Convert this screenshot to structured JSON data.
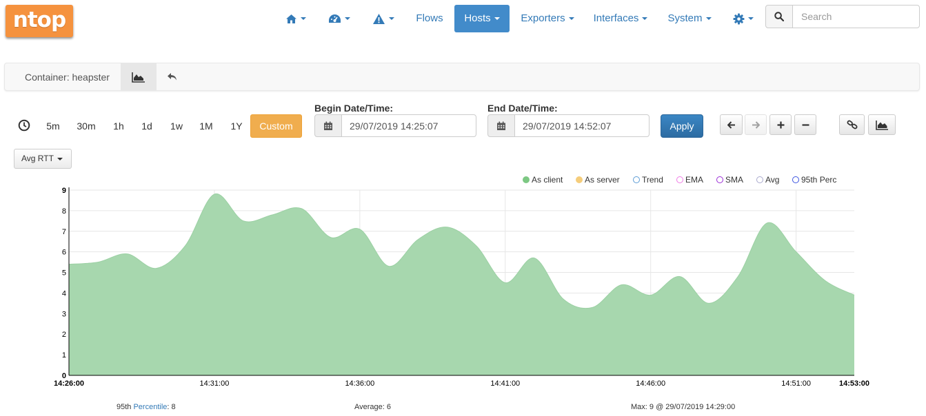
{
  "app": {
    "logo_text": "ntop"
  },
  "nav": {
    "home_icon": "home-icon",
    "dashboard_icon": "dashboard-icon",
    "alerts_icon": "warning-icon",
    "flows": "Flows",
    "hosts": "Hosts",
    "exporters": "Exporters",
    "interfaces": "Interfaces",
    "system": "System",
    "settings_icon": "gear-icon"
  },
  "search": {
    "placeholder": "Search",
    "value": ""
  },
  "container_bar": {
    "title": "Container: heapster"
  },
  "time_ranges": [
    "5m",
    "30m",
    "1h",
    "1d",
    "1w",
    "1M",
    "1Y"
  ],
  "custom_label": "Custom",
  "begin": {
    "label": "Begin Date/Time:",
    "value": "29/07/2019 14:25:07"
  },
  "end": {
    "label": "End Date/Time:",
    "value": "29/07/2019 14:52:07"
  },
  "apply_label": "Apply",
  "metric_select": {
    "value": "Avg RTT"
  },
  "legend": [
    {
      "label": "As client",
      "color": "#7dc883",
      "filled": true
    },
    {
      "label": "As server",
      "color": "#f5cd7b",
      "filled": true
    },
    {
      "label": "Trend",
      "color": "#5b9bd5",
      "filled": false
    },
    {
      "label": "EMA",
      "color": "#f07ae6",
      "filled": false
    },
    {
      "label": "SMA",
      "color": "#9b2bd6",
      "filled": false
    },
    {
      "label": "Avg",
      "color": "#a8a8cc",
      "filled": false
    },
    {
      "label": "95th Perc",
      "color": "#3b53e0",
      "filled": false
    }
  ],
  "chart_data": {
    "type": "area",
    "series": [
      {
        "name": "As client",
        "color": "#a7d7ae",
        "x": [
          "14:26:00",
          "14:27:00",
          "14:28:00",
          "14:29:00",
          "14:30:00",
          "14:31:00",
          "14:32:00",
          "14:33:00",
          "14:34:00",
          "14:35:00",
          "14:36:00",
          "14:37:00",
          "14:38:00",
          "14:39:00",
          "14:40:00",
          "14:41:00",
          "14:42:00",
          "14:43:00",
          "14:44:00",
          "14:45:00",
          "14:46:00",
          "14:47:00",
          "14:48:00",
          "14:49:00",
          "14:50:00",
          "14:51:00",
          "14:52:00",
          "14:53:00"
        ],
        "values": [
          5.4,
          5.5,
          5.9,
          5.2,
          6.3,
          8.8,
          7.5,
          7.8,
          8.1,
          6.7,
          7.1,
          5.3,
          6.6,
          7.2,
          6.3,
          4.5,
          5.7,
          3.7,
          3.3,
          4.4,
          3.9,
          4.8,
          3.5,
          4.8,
          7.4,
          6.0,
          4.6,
          3.9
        ]
      }
    ],
    "x_ticks": [
      "14:26:00",
      "14:31:00",
      "14:36:00",
      "14:41:00",
      "14:46:00",
      "14:51:00",
      "14:53:00"
    ],
    "y_ticks": [
      0,
      1,
      2,
      3,
      4,
      5,
      6,
      7,
      8,
      9
    ],
    "ylim": [
      0,
      9
    ],
    "grid": true,
    "legend_position": "top-right"
  },
  "footer": {
    "perc_prefix": "95th ",
    "perc_link": "Percentile",
    "perc_value": ": 8",
    "average": "Average: 6",
    "max": "Max: 9 @ 29/07/2019 14:29:00"
  }
}
